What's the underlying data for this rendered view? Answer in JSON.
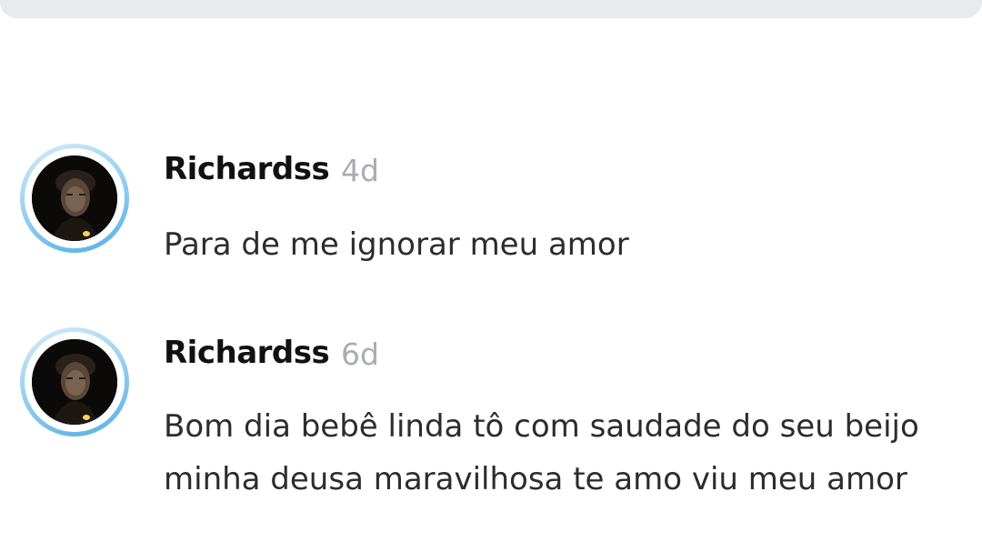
{
  "comments": [
    {
      "username": "Richardss",
      "time": "4d",
      "text": "Para de me ignorar meu amor"
    },
    {
      "username": "Richardss",
      "time": "6d",
      "text": "Bom dia bebê linda tô com saudade do seu beijo minha deusa maravilhosa te amo viu meu amor"
    }
  ],
  "colors": {
    "ring": "#55aee5",
    "username": "#111111",
    "time": "#a9acb2",
    "text": "#2c2c2c"
  }
}
